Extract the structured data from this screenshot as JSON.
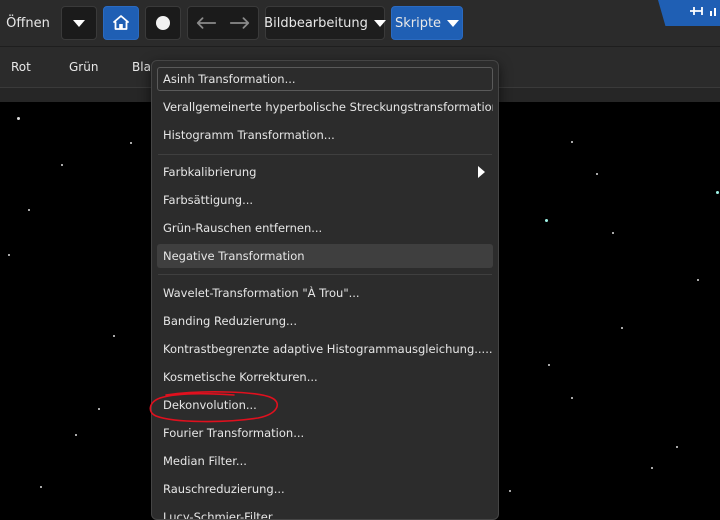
{
  "toolbar": {
    "open_label": "Öffnen",
    "edit_menu_label": "Bildbearbeitung",
    "scripts_label": "Skripte",
    "icons": {
      "dropdown": "chevron-down-icon",
      "home": "home-icon",
      "record": "circle-icon",
      "undo": "undo-icon",
      "redo": "redo-icon"
    }
  },
  "tabs": [
    "Rot",
    "Grün",
    "Blau"
  ],
  "menu": {
    "items": [
      {
        "label": "Asinh Transformation..."
      },
      {
        "label": "Verallgemeinerte hyperbolische Streckungstransformationen..."
      },
      {
        "label": "Histogramm Transformation..."
      },
      {
        "label": "Farbkalibrierung"
      },
      {
        "label": "Farbsättigung..."
      },
      {
        "label": "Grün-Rauschen entfernen..."
      },
      {
        "label": "Negative Transformation"
      },
      {
        "label": "Wavelet-Transformation \"À Trou\"..."
      },
      {
        "label": "Banding Reduzierung..."
      },
      {
        "label": "Kontrastbegrenzte adaptive Histogrammausgleichung....."
      },
      {
        "label": "Kosmetische Korrekturen..."
      },
      {
        "label": "Dekonvolution..."
      },
      {
        "label": "Fourier Transformation..."
      },
      {
        "label": "Median Filter..."
      },
      {
        "label": "Rauschreduzierung..."
      },
      {
        "label": "Lucy-Schmier-Filter..."
      }
    ]
  },
  "colors": {
    "accent": "#1f5fb4",
    "menu_bg": "#2c2c2c",
    "annotation": "#e0101e"
  }
}
